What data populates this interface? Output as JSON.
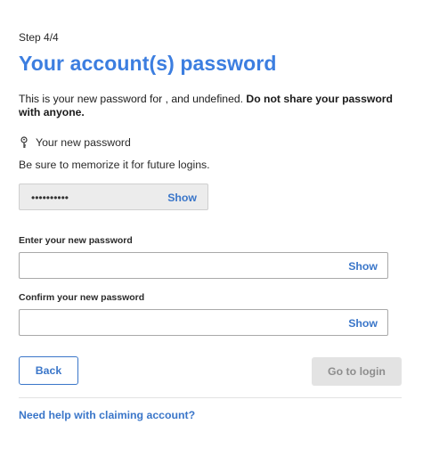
{
  "step": "Step 4/4",
  "title": "Your account(s) password",
  "description": {
    "text": "This is your new password for , and undefined. ",
    "warning": "Do not share your password with anyone."
  },
  "new_password": {
    "icon": "key-icon",
    "heading": "Your new password",
    "hint": "Be sure to memorize it for future logins.",
    "masked_value": "••••••••••",
    "show_label": "Show"
  },
  "enter_field": {
    "label": "Enter your new password",
    "value": "",
    "show_label": "Show"
  },
  "confirm_field": {
    "label": "Confirm your new password",
    "value": "",
    "show_label": "Show"
  },
  "buttons": {
    "back": "Back",
    "go_to_login": "Go to login"
  },
  "help_link": "Need help with claiming account?",
  "colors": {
    "accent": "#3c7ee0",
    "link": "#3a76c9",
    "disabled_bg": "#e3e3e3",
    "disabled_text": "#8d8d8d"
  }
}
